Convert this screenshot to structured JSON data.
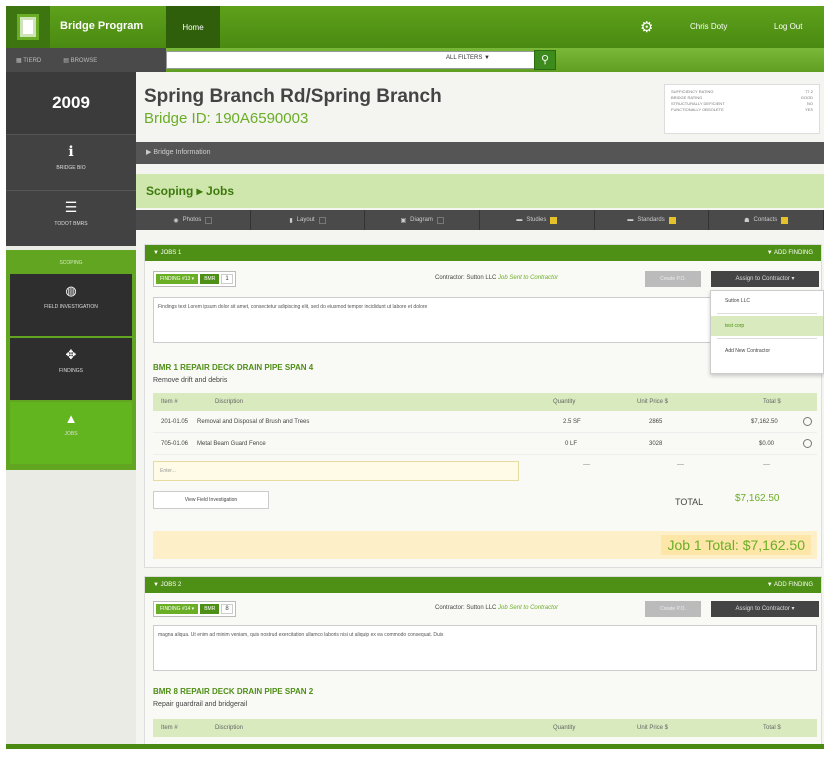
{
  "nav": {
    "brand": "Bridge Program",
    "home": "Home",
    "user": "Chris Doty",
    "logout": "Log Out",
    "tiered": "TIERD",
    "browse": "BROWSE",
    "filters": "ALL FILTERS ▼"
  },
  "sidebar": {
    "year": "2009",
    "bridge_bio": "BRIDGE BIO",
    "todot_bmrs": "TODOT BMRS",
    "scoping": "SCOPING",
    "field_investigation": "FIELD INVESTIGATION",
    "findings": "FINDINGS",
    "jobs": "JOBS"
  },
  "header": {
    "title": "Spring Branch Rd/Spring Branch",
    "bridge_id": "Bridge ID: 190A6590003",
    "ratings": [
      {
        "label": "SUFFICIENCY RATING",
        "value": "77.2"
      },
      {
        "label": "BRIDGE RATING",
        "value": "GOOD"
      },
      {
        "label": "STRUCTURALLY DEFICIENT",
        "value": "NO"
      },
      {
        "label": "FUNCTIONALLY OBSOLETE",
        "value": "YES"
      }
    ],
    "bridge_info": "▶ Bridge Information"
  },
  "scoping": {
    "breadcrumb": "Scoping ▸ Jobs"
  },
  "tabs": {
    "photos": "Photos",
    "layout": "Layout",
    "diagram": "Diagram",
    "studies": "Studies",
    "standards": "Standards",
    "contacts": "Contacts"
  },
  "job1": {
    "header": "▼ JOBS 1",
    "add_finding": "▼ ADD FINDING",
    "finding_tag": "FINDING #13 ▾",
    "bmr_tag": "BMR",
    "bmr_count": "1",
    "contractor_label": "Contractor: Sutton LLC",
    "contractor_status": "Job Sent to Contractor",
    "grey_btn": "Create P.O.",
    "assign_btn": "Assign to Contractor ▾",
    "findings_text": "Findings text Lorem ipsum dolor sit amet, consectetur adipiscing elit, sed do eiusmod tempor incididunt ut labore et dolore",
    "bmr_title": "BMR 1 REPAIR DECK DRAIN PIPE SPAN 4",
    "bmr_sub": "Remove drift and debris",
    "cols": {
      "item": "Item #",
      "desc": "Discription",
      "qty": "Quantity",
      "price": "Unit Price $",
      "total": "Total $"
    },
    "rows": [
      {
        "item": "201-01.05",
        "desc": "Removal and Disposal of Brush and Trees",
        "qty": "2.5 SF",
        "price": "2865",
        "total": "$7,162.50"
      },
      {
        "item": "705-01.06",
        "desc": "Metal Beam Guard Fence",
        "qty": "0 LF",
        "price": "3028",
        "total": "$0.00"
      }
    ],
    "enter_placeholder": "Enter...",
    "dashes": "—",
    "view_btn": "View Field Investigation",
    "total_label": "TOTAL",
    "total_value": "$7,162.50",
    "job_total": "Job 1 Total: $7,162.50"
  },
  "dropdown": {
    "items": [
      "Sutton LLC",
      "test corp",
      "Add New Contractor"
    ]
  },
  "job2": {
    "header": "▼ JOBS 2",
    "add_finding": "▼ ADD FINDING",
    "finding_tag": "FINDING #14 ▾",
    "bmr_tag": "BMR",
    "bmr_count": "8",
    "contractor_label": "Contractor: Sutton LLC",
    "contractor_status": "Job Sent to Contractor",
    "grey_btn": "Create P.O.",
    "assign_btn": "Assign to Contractor ▾",
    "findings_text": "magna aliqua. Ut enim ad minim veniam, quis nostrud exercitation ullamco laboris nisi ut aliquip ex ea commodo consequat. Duis",
    "bmr_title": "BMR 8 REPAIR DECK DRAIN PIPE SPAN 2",
    "bmr_sub": "Repair guardrail and bridgerail",
    "cols": {
      "item": "Item #",
      "desc": "Discription",
      "qty": "Quantity",
      "price": "Unit Price $",
      "total": "Total $"
    }
  }
}
